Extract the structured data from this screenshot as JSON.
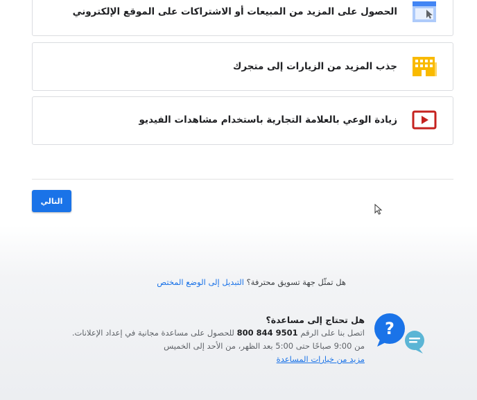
{
  "cards": [
    {
      "label": "الحصول على المزيد من المبيعات أو الاشتراكات على الموقع الإلكتروني",
      "icon": "website-window-icon"
    },
    {
      "label": "جذب المزيد من الزيارات إلى متجرك",
      "icon": "storefront-building-icon"
    },
    {
      "label": "زيادة الوعي بالعلامة التجارية باستخدام مشاهدات الفيديو",
      "icon": "video-play-icon"
    }
  ],
  "next_button": "التالي",
  "agency": {
    "question": "هل تمثّل جهة تسويق محترفة؟",
    "switch_link": "التبديل إلى الوضع المختص"
  },
  "help": {
    "title": "هل تحتاج إلى مساعدة؟",
    "line1_before": "اتصل بنا على الرقم",
    "phone": "9501 844 800",
    "line1_after": "للحصول على مساعدة مجانية في إعداد الإعلانات.",
    "line2": "من 9:00 صباحًا حتى 5:00 بعد الظهر، من الأحد إلى الخميس",
    "more_link": "مزيد من خيارات المساعدة"
  },
  "colors": {
    "primary_blue": "#1a73e8",
    "icon_yellow": "#f9ba00",
    "icon_red": "#c5221f",
    "help_bubble_blue": "#1a73e8",
    "help_bubble_teal": "#5bb5d5"
  }
}
